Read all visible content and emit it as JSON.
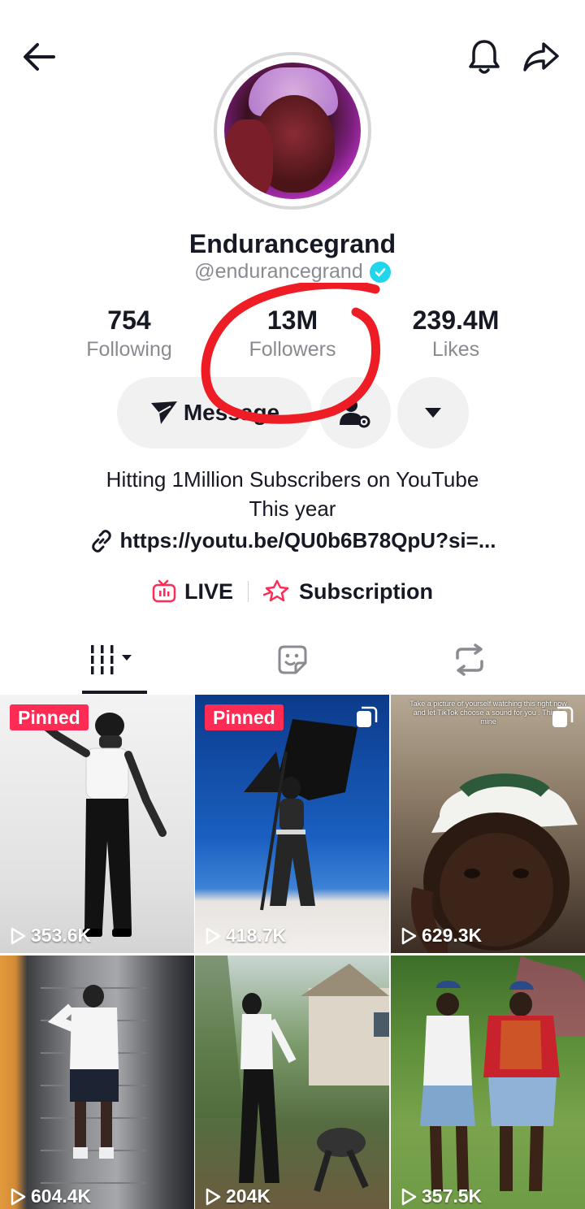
{
  "header": {
    "back_icon": "arrow-left-icon",
    "bell_icon": "bell-icon",
    "share_icon": "share-arrow-icon"
  },
  "profile": {
    "display_name": "Endurancegrand",
    "handle": "@endurancegrand",
    "verified": true
  },
  "stats": [
    {
      "value": "754",
      "label": "Following"
    },
    {
      "value": "13M",
      "label": "Followers"
    },
    {
      "value": "239.4M",
      "label": "Likes"
    }
  ],
  "actions": {
    "message_label": "Message",
    "add_friend_icon": "person-settings-icon",
    "more_icon": "caret-down-icon"
  },
  "bio": {
    "line1": "Hitting 1Million Subscribers on YouTube",
    "line2": "This year",
    "link": "https://youtu.be/QU0b6B78QpU?si=..."
  },
  "badges": {
    "live_label": "LIVE",
    "subscription_label": "Subscription"
  },
  "tabs": [
    {
      "icon": "videos-grid-icon"
    },
    {
      "icon": "sticker-icon"
    },
    {
      "icon": "repost-icon"
    }
  ],
  "videos": [
    {
      "views": "353.6K",
      "pinned": "Pinned"
    },
    {
      "views": "418.7K",
      "pinned": "Pinned"
    },
    {
      "views": "629.3K",
      "caption": "Take a picture of yourself watching this right now and let TikTok choose a sound for you . This is mine"
    },
    {
      "views": "604.4K"
    },
    {
      "views": "204K"
    },
    {
      "views": "357.5K"
    }
  ],
  "colors": {
    "accent_red": "#fe2c55",
    "verified_blue": "#20d5ec",
    "annotation_red": "#ee1c25",
    "button_bg": "#f1f1f2"
  }
}
